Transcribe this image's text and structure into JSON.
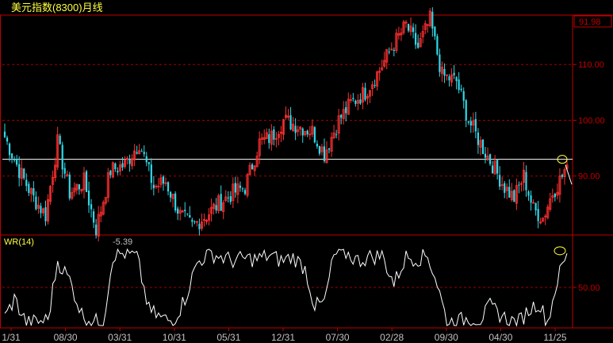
{
  "window": {
    "title": "美元指数(8300)月线"
  },
  "colors": {
    "background": "#000000",
    "frame": "#c00000",
    "grid": "#a00000",
    "up": "#ff3030",
    "down": "#30d8e8",
    "wr_line": "#ffffff",
    "label": "#ffff40",
    "axis_text": "#c0c0c0",
    "value_box": "#c00000"
  },
  "price_panel": {
    "last_price_label": "91.98",
    "ylim": [
      80,
      118
    ],
    "y_ticks": [
      {
        "value": 110,
        "label": "110.00"
      },
      {
        "value": 100,
        "label": "100.00"
      },
      {
        "value": 90,
        "label": "90.00"
      }
    ],
    "horizontal_line": 93.0
  },
  "indicator_panel": {
    "name_label": "WR(14)",
    "value_label": "-5.39",
    "ylim": [
      0,
      100
    ],
    "y_ticks": [
      {
        "value": 50,
        "label": "50.00"
      }
    ]
  },
  "x_axis_labels": [
    "1/31",
    "08/30",
    "03/31",
    "10/31",
    "05/31",
    "12/31",
    "07/30",
    "02/28",
    "09/30",
    "04/30",
    "11/25"
  ],
  "chart_data": {
    "type": "candlestick",
    "title": "美元指数(8300)月线",
    "price_ylim": [
      80,
      118
    ],
    "wr_ylim": [
      0,
      100
    ],
    "x_labels": [
      "1/31",
      "08/30",
      "03/31",
      "10/31",
      "05/31",
      "12/31",
      "07/30",
      "02/28",
      "09/30",
      "04/30",
      "11/25"
    ],
    "price_close_waypoints": [
      [
        0,
        97
      ],
      [
        6,
        91
      ],
      [
        12,
        86
      ],
      [
        17,
        83
      ],
      [
        22,
        96
      ],
      [
        27,
        87
      ],
      [
        33,
        89
      ],
      [
        38,
        80.5
      ],
      [
        44,
        91
      ],
      [
        50,
        92
      ],
      [
        56,
        96
      ],
      [
        62,
        88
      ],
      [
        67,
        89
      ],
      [
        73,
        83
      ],
      [
        78,
        81
      ],
      [
        84,
        83
      ],
      [
        89,
        85
      ],
      [
        95,
        87
      ],
      [
        100,
        88
      ],
      [
        106,
        96
      ],
      [
        111,
        97
      ],
      [
        116,
        100
      ],
      [
        122,
        99
      ],
      [
        128,
        98
      ],
      [
        133,
        94
      ],
      [
        139,
        100
      ],
      [
        144,
        103
      ],
      [
        150,
        105
      ],
      [
        156,
        109
      ],
      [
        161,
        113
      ],
      [
        167,
        117
      ],
      [
        172,
        113
      ],
      [
        177,
        118
      ],
      [
        182,
        108
      ],
      [
        188,
        107
      ],
      [
        193,
        100
      ],
      [
        199,
        95
      ],
      [
        203,
        92
      ],
      [
        208,
        88
      ],
      [
        212,
        86
      ],
      [
        216,
        90
      ],
      [
        220,
        84
      ],
      [
        224,
        82.5
      ],
      [
        228,
        87
      ],
      [
        232,
        90
      ],
      [
        234,
        91.98
      ]
    ],
    "wr_waypoints": [
      [
        0,
        10
      ],
      [
        4,
        35
      ],
      [
        9,
        3
      ],
      [
        14,
        5
      ],
      [
        18,
        8
      ],
      [
        22,
        85
      ],
      [
        27,
        60
      ],
      [
        32,
        15
      ],
      [
        37,
        5
      ],
      [
        41,
        5
      ],
      [
        45,
        92
      ],
      [
        50,
        95
      ],
      [
        55,
        90
      ],
      [
        60,
        20
      ],
      [
        65,
        10
      ],
      [
        70,
        5
      ],
      [
        75,
        35
      ],
      [
        80,
        82
      ],
      [
        85,
        95
      ],
      [
        90,
        90
      ],
      [
        95,
        85
      ],
      [
        100,
        88
      ],
      [
        105,
        87
      ],
      [
        110,
        92
      ],
      [
        115,
        85
      ],
      [
        120,
        90
      ],
      [
        125,
        75
      ],
      [
        129,
        25
      ],
      [
        133,
        30
      ],
      [
        137,
        92
      ],
      [
        142,
        95
      ],
      [
        147,
        85
      ],
      [
        152,
        90
      ],
      [
        157,
        92
      ],
      [
        162,
        55
      ],
      [
        167,
        90
      ],
      [
        172,
        88
      ],
      [
        176,
        92
      ],
      [
        180,
        55
      ],
      [
        184,
        5
      ],
      [
        188,
        5
      ],
      [
        193,
        10
      ],
      [
        198,
        8
      ],
      [
        202,
        25
      ],
      [
        206,
        15
      ],
      [
        210,
        6
      ],
      [
        214,
        5
      ],
      [
        218,
        20
      ],
      [
        222,
        30
      ],
      [
        226,
        5
      ],
      [
        230,
        60
      ],
      [
        234,
        94.61
      ]
    ]
  }
}
